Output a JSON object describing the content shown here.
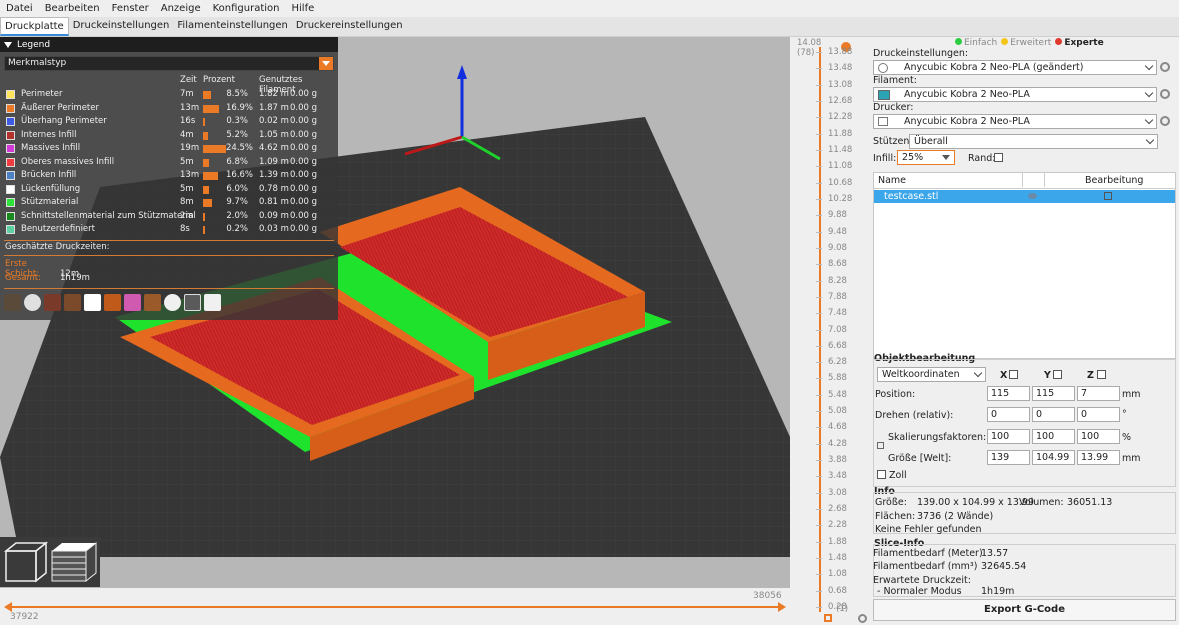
{
  "menu": [
    "Datei",
    "Bearbeiten",
    "Fenster",
    "Anzeige",
    "Konfiguration",
    "Hilfe"
  ],
  "tabs": [
    {
      "label": "Druckplatte",
      "active": true
    },
    {
      "label": "Druckeinstellungen",
      "active": false
    },
    {
      "label": "Filamenteinstellungen",
      "active": false
    },
    {
      "label": "Druckereinstellungen",
      "active": false
    }
  ],
  "legend": {
    "title": "Legend",
    "view_type": "Merkmalstyp",
    "col_time": "Zeit",
    "col_percent": "Prozent",
    "col_filament": "Genutztes Filament",
    "rows": [
      {
        "name": "Perimeter",
        "color": "#ffe45b",
        "time": "7m",
        "percent": "8.5%",
        "fraction": 0.085,
        "length": "1.82 m",
        "weight": "0.00 g"
      },
      {
        "name": "Äußerer Perimeter",
        "color": "#ea7a25",
        "time": "13m",
        "percent": "16.9%",
        "fraction": 0.169,
        "length": "1.87 m",
        "weight": "0.00 g"
      },
      {
        "name": "Überhang Perimeter",
        "color": "#3c5ce5",
        "time": "16s",
        "percent": "0.3%",
        "fraction": 0.003,
        "length": "0.02 m",
        "weight": "0.00 g"
      },
      {
        "name": "Internes Infill",
        "color": "#b3322d",
        "time": "4m",
        "percent": "5.2%",
        "fraction": 0.052,
        "length": "1.05 m",
        "weight": "0.00 g"
      },
      {
        "name": "Massives Infill",
        "color": "#d13ad7",
        "time": "19m",
        "percent": "24.5%",
        "fraction": 0.245,
        "length": "4.62 m",
        "weight": "0.00 g"
      },
      {
        "name": "Oberes massives Infill",
        "color": "#f03b40",
        "time": "5m",
        "percent": "6.8%",
        "fraction": 0.068,
        "length": "1.09 m",
        "weight": "0.00 g"
      },
      {
        "name": "Brücken Infill",
        "color": "#4d81c4",
        "time": "13m",
        "percent": "16.6%",
        "fraction": 0.166,
        "length": "1.39 m",
        "weight": "0.00 g"
      },
      {
        "name": "Lückenfüllung",
        "color": "#ffffff",
        "time": "5m",
        "percent": "6.0%",
        "fraction": 0.06,
        "length": "0.78 m",
        "weight": "0.00 g"
      },
      {
        "name": "Stützmaterial",
        "color": "#2de23a",
        "time": "8m",
        "percent": "9.7%",
        "fraction": 0.097,
        "length": "0.81 m",
        "weight": "0.00 g"
      },
      {
        "name": "Schnittstellenmaterial zum Stützmaterial",
        "color": "#1b8a1e",
        "time": "2m",
        "percent": "2.0%",
        "fraction": 0.02,
        "length": "0.09 m",
        "weight": "0.00 g"
      },
      {
        "name": "Benutzerdefiniert",
        "color": "#5dcfa0",
        "time": "8s",
        "percent": "0.2%",
        "fraction": 0.002,
        "length": "0.03 m",
        "weight": "0.00 g"
      }
    ],
    "estimated_label": "Geschätzte Druckzeiten:",
    "first_layer_label": "Erste Schicht:",
    "first_layer_value": "12m",
    "total_label": "Gesamt:",
    "total_value": "1h19m"
  },
  "hslider": {
    "left_value": "37922",
    "right_value": "38056"
  },
  "vslider": {
    "top_value": "14.08",
    "top_count": "(78)",
    "bottom_value": "0.28",
    "bottom_count": "(1)",
    "ticks": [
      "13.88",
      "13.48",
      "13.08",
      "12.68",
      "12.28",
      "11.88",
      "11.48",
      "11.08",
      "10.68",
      "10.28",
      "9.88",
      "9.48",
      "9.08",
      "8.68",
      "8.28",
      "7.88",
      "7.48",
      "7.08",
      "6.68",
      "6.28",
      "5.88",
      "5.48",
      "5.08",
      "4.68",
      "4.28",
      "3.88",
      "3.48",
      "3.08",
      "2.68",
      "2.28",
      "1.88",
      "1.48",
      "1.08",
      "0.68",
      "0.28"
    ]
  },
  "panel": {
    "modes": [
      {
        "label": "Einfach",
        "color": "#2ecc40"
      },
      {
        "label": "Erweitert",
        "color": "#f3c51a"
      },
      {
        "label": "Experte",
        "color": "#e03a2f"
      }
    ],
    "print_settings_label": "Druckeinstellungen:",
    "print_settings_value": "Anycubic Kobra 2 Neo-PLA (geändert)",
    "filament_label": "Filament:",
    "filament_value": "Anycubic Kobra 2 Neo-PLA",
    "printer_label": "Drucker:",
    "printer_value": "Anycubic Kobra 2 Neo-PLA",
    "supports_label": "Stützen:",
    "supports_value": "Überall",
    "infill_label": "Infill:",
    "infill_value": "25%",
    "brim_label": "Rand:",
    "list_col_name": "Name",
    "list_col_edit": "Bearbeitung",
    "object_name": "testcase.stl",
    "objedit_title": "Objektbearbeitung",
    "coord_system": "Weltkoordinaten",
    "axis_x": "X",
    "axis_y": "Y",
    "axis_z": "Z",
    "position_label": "Position:",
    "position": [
      "115",
      "115",
      "7"
    ],
    "position_unit": "mm",
    "rotate_label": "Drehen (relativ):",
    "rotate": [
      "0",
      "0",
      "0"
    ],
    "rotate_unit": "°",
    "scale_label": "Skalierungsfaktoren:",
    "scale": [
      "100",
      "100",
      "100"
    ],
    "scale_unit": "%",
    "size_label": "Größe [Welt]:",
    "size": [
      "139",
      "104.99",
      "13.99"
    ],
    "size_unit": "mm",
    "inch_label": "Zoll",
    "info_title": "Info",
    "info_size_label": "Größe:",
    "info_size_value": "139.00 x 104.99 x 13.99",
    "info_volume_label": "Volumen:",
    "info_volume_value": "36051.13",
    "info_facets_label": "Flächen:",
    "info_facets_value": "3736 (2 Wände)",
    "info_errors": "Keine Fehler gefunden",
    "slice_title": "Slice-Info",
    "slice_meters_label": "Filamentbedarf (Meter)",
    "slice_meters_value": "13.57",
    "slice_mm3_label": "Filamentbedarf (mm³)",
    "slice_mm3_value": "32645.54",
    "slice_time_label": "Erwartete Druckzeit:",
    "slice_mode_label": "- Normaler Modus",
    "slice_mode_value": "1h19m",
    "export_label": "Export G-Code"
  }
}
